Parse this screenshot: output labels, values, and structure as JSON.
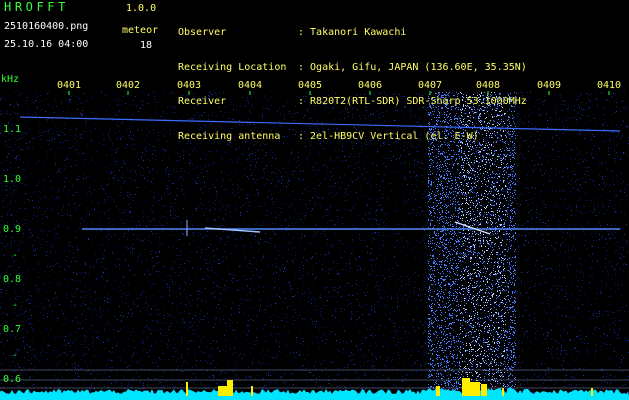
{
  "app": {
    "title": "HROFFT",
    "version": "1.0.0"
  },
  "file": {
    "name": "2510160400.png",
    "datetime": "25.10.16 04:00"
  },
  "detection": {
    "label": "meteor",
    "count": "18"
  },
  "info": [
    {
      "key": "Observer",
      "value": ": Takanori Kawachi"
    },
    {
      "key": "Receiving Location",
      "value": ": Ogaki, Gifu, JAPAN (136.60E, 35.35N)"
    },
    {
      "key": "Receiver",
      "value": ": R820T2(RTL-SDR) SDR-Sharp 53.1000MHz"
    },
    {
      "key": "Receiving antenna",
      "value": ": 2el-HB9CV Vertical (el. E-W)"
    }
  ],
  "axis": {
    "unit": "kHz",
    "y_ticks": [
      "1.1",
      "1.0",
      "0.9",
      "0.85",
      "0.8",
      "0.75",
      "0.7",
      "0.65",
      "0.6"
    ],
    "y_display": [
      "1.1",
      "1.0",
      "0.9",
      "",
      "0.8",
      "",
      "0.7",
      "",
      "0.6"
    ],
    "x_ticks": [
      "0401",
      "0402",
      "0403",
      "0404",
      "0405",
      "0406",
      "0407",
      "0408",
      "0409",
      "0410"
    ]
  },
  "colors": {
    "background": "#000000",
    "noise": "#0a1a6e",
    "signal": "#4d7dff",
    "bright_signal": "#b8d0ff",
    "baseline": "#00e5ff",
    "meteor_burst": "#ffee00",
    "header_text": "#ffff66",
    "tick_text": "#33ff33"
  }
}
